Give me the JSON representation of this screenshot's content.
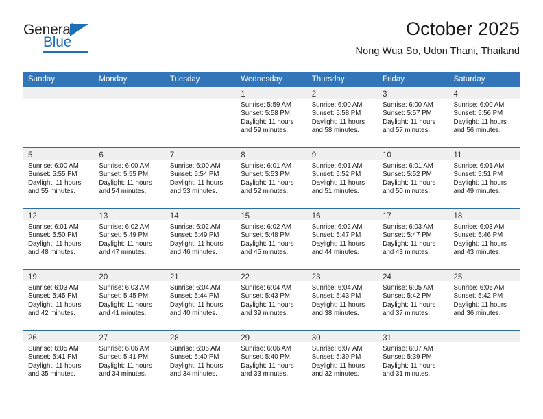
{
  "brand": {
    "name_top": "General",
    "name_bottom": "Blue",
    "logo_icon": "triangle-icon",
    "accent_color": "#1f6fb4"
  },
  "header": {
    "title": "October 2025",
    "subtitle": "Nong Wua So, Udon Thani, Thailand"
  },
  "colors": {
    "header_blue": "#3275b8",
    "row_divider": "#2e6da4",
    "day_band": "#f0f0f0"
  },
  "weekdays": [
    "Sunday",
    "Monday",
    "Tuesday",
    "Wednesday",
    "Thursday",
    "Friday",
    "Saturday"
  ],
  "weeks": [
    [
      {
        "day": "",
        "sunrise": "",
        "sunset": "",
        "daylight1": "",
        "daylight2": "",
        "empty": true
      },
      {
        "day": "",
        "sunrise": "",
        "sunset": "",
        "daylight1": "",
        "daylight2": "",
        "empty": true
      },
      {
        "day": "",
        "sunrise": "",
        "sunset": "",
        "daylight1": "",
        "daylight2": "",
        "empty": true
      },
      {
        "day": "1",
        "sunrise": "Sunrise: 5:59 AM",
        "sunset": "Sunset: 5:58 PM",
        "daylight1": "Daylight: 11 hours",
        "daylight2": "and 59 minutes."
      },
      {
        "day": "2",
        "sunrise": "Sunrise: 6:00 AM",
        "sunset": "Sunset: 5:58 PM",
        "daylight1": "Daylight: 11 hours",
        "daylight2": "and 58 minutes."
      },
      {
        "day": "3",
        "sunrise": "Sunrise: 6:00 AM",
        "sunset": "Sunset: 5:57 PM",
        "daylight1": "Daylight: 11 hours",
        "daylight2": "and 57 minutes."
      },
      {
        "day": "4",
        "sunrise": "Sunrise: 6:00 AM",
        "sunset": "Sunset: 5:56 PM",
        "daylight1": "Daylight: 11 hours",
        "daylight2": "and 56 minutes."
      }
    ],
    [
      {
        "day": "5",
        "sunrise": "Sunrise: 6:00 AM",
        "sunset": "Sunset: 5:55 PM",
        "daylight1": "Daylight: 11 hours",
        "daylight2": "and 55 minutes."
      },
      {
        "day": "6",
        "sunrise": "Sunrise: 6:00 AM",
        "sunset": "Sunset: 5:55 PM",
        "daylight1": "Daylight: 11 hours",
        "daylight2": "and 54 minutes."
      },
      {
        "day": "7",
        "sunrise": "Sunrise: 6:00 AM",
        "sunset": "Sunset: 5:54 PM",
        "daylight1": "Daylight: 11 hours",
        "daylight2": "and 53 minutes."
      },
      {
        "day": "8",
        "sunrise": "Sunrise: 6:01 AM",
        "sunset": "Sunset: 5:53 PM",
        "daylight1": "Daylight: 11 hours",
        "daylight2": "and 52 minutes."
      },
      {
        "day": "9",
        "sunrise": "Sunrise: 6:01 AM",
        "sunset": "Sunset: 5:52 PM",
        "daylight1": "Daylight: 11 hours",
        "daylight2": "and 51 minutes."
      },
      {
        "day": "10",
        "sunrise": "Sunrise: 6:01 AM",
        "sunset": "Sunset: 5:52 PM",
        "daylight1": "Daylight: 11 hours",
        "daylight2": "and 50 minutes."
      },
      {
        "day": "11",
        "sunrise": "Sunrise: 6:01 AM",
        "sunset": "Sunset: 5:51 PM",
        "daylight1": "Daylight: 11 hours",
        "daylight2": "and 49 minutes."
      }
    ],
    [
      {
        "day": "12",
        "sunrise": "Sunrise: 6:01 AM",
        "sunset": "Sunset: 5:50 PM",
        "daylight1": "Daylight: 11 hours",
        "daylight2": "and 48 minutes."
      },
      {
        "day": "13",
        "sunrise": "Sunrise: 6:02 AM",
        "sunset": "Sunset: 5:49 PM",
        "daylight1": "Daylight: 11 hours",
        "daylight2": "and 47 minutes."
      },
      {
        "day": "14",
        "sunrise": "Sunrise: 6:02 AM",
        "sunset": "Sunset: 5:49 PM",
        "daylight1": "Daylight: 11 hours",
        "daylight2": "and 46 minutes."
      },
      {
        "day": "15",
        "sunrise": "Sunrise: 6:02 AM",
        "sunset": "Sunset: 5:48 PM",
        "daylight1": "Daylight: 11 hours",
        "daylight2": "and 45 minutes."
      },
      {
        "day": "16",
        "sunrise": "Sunrise: 6:02 AM",
        "sunset": "Sunset: 5:47 PM",
        "daylight1": "Daylight: 11 hours",
        "daylight2": "and 44 minutes."
      },
      {
        "day": "17",
        "sunrise": "Sunrise: 6:03 AM",
        "sunset": "Sunset: 5:47 PM",
        "daylight1": "Daylight: 11 hours",
        "daylight2": "and 43 minutes."
      },
      {
        "day": "18",
        "sunrise": "Sunrise: 6:03 AM",
        "sunset": "Sunset: 5:46 PM",
        "daylight1": "Daylight: 11 hours",
        "daylight2": "and 43 minutes."
      }
    ],
    [
      {
        "day": "19",
        "sunrise": "Sunrise: 6:03 AM",
        "sunset": "Sunset: 5:45 PM",
        "daylight1": "Daylight: 11 hours",
        "daylight2": "and 42 minutes."
      },
      {
        "day": "20",
        "sunrise": "Sunrise: 6:03 AM",
        "sunset": "Sunset: 5:45 PM",
        "daylight1": "Daylight: 11 hours",
        "daylight2": "and 41 minutes."
      },
      {
        "day": "21",
        "sunrise": "Sunrise: 6:04 AM",
        "sunset": "Sunset: 5:44 PM",
        "daylight1": "Daylight: 11 hours",
        "daylight2": "and 40 minutes."
      },
      {
        "day": "22",
        "sunrise": "Sunrise: 6:04 AM",
        "sunset": "Sunset: 5:43 PM",
        "daylight1": "Daylight: 11 hours",
        "daylight2": "and 39 minutes."
      },
      {
        "day": "23",
        "sunrise": "Sunrise: 6:04 AM",
        "sunset": "Sunset: 5:43 PM",
        "daylight1": "Daylight: 11 hours",
        "daylight2": "and 38 minutes."
      },
      {
        "day": "24",
        "sunrise": "Sunrise: 6:05 AM",
        "sunset": "Sunset: 5:42 PM",
        "daylight1": "Daylight: 11 hours",
        "daylight2": "and 37 minutes."
      },
      {
        "day": "25",
        "sunrise": "Sunrise: 6:05 AM",
        "sunset": "Sunset: 5:42 PM",
        "daylight1": "Daylight: 11 hours",
        "daylight2": "and 36 minutes."
      }
    ],
    [
      {
        "day": "26",
        "sunrise": "Sunrise: 6:05 AM",
        "sunset": "Sunset: 5:41 PM",
        "daylight1": "Daylight: 11 hours",
        "daylight2": "and 35 minutes."
      },
      {
        "day": "27",
        "sunrise": "Sunrise: 6:06 AM",
        "sunset": "Sunset: 5:41 PM",
        "daylight1": "Daylight: 11 hours",
        "daylight2": "and 34 minutes."
      },
      {
        "day": "28",
        "sunrise": "Sunrise: 6:06 AM",
        "sunset": "Sunset: 5:40 PM",
        "daylight1": "Daylight: 11 hours",
        "daylight2": "and 34 minutes."
      },
      {
        "day": "29",
        "sunrise": "Sunrise: 6:06 AM",
        "sunset": "Sunset: 5:40 PM",
        "daylight1": "Daylight: 11 hours",
        "daylight2": "and 33 minutes."
      },
      {
        "day": "30",
        "sunrise": "Sunrise: 6:07 AM",
        "sunset": "Sunset: 5:39 PM",
        "daylight1": "Daylight: 11 hours",
        "daylight2": "and 32 minutes."
      },
      {
        "day": "31",
        "sunrise": "Sunrise: 6:07 AM",
        "sunset": "Sunset: 5:39 PM",
        "daylight1": "Daylight: 11 hours",
        "daylight2": "and 31 minutes."
      },
      {
        "day": "",
        "sunrise": "",
        "sunset": "",
        "daylight1": "",
        "daylight2": "",
        "empty": true
      }
    ]
  ]
}
